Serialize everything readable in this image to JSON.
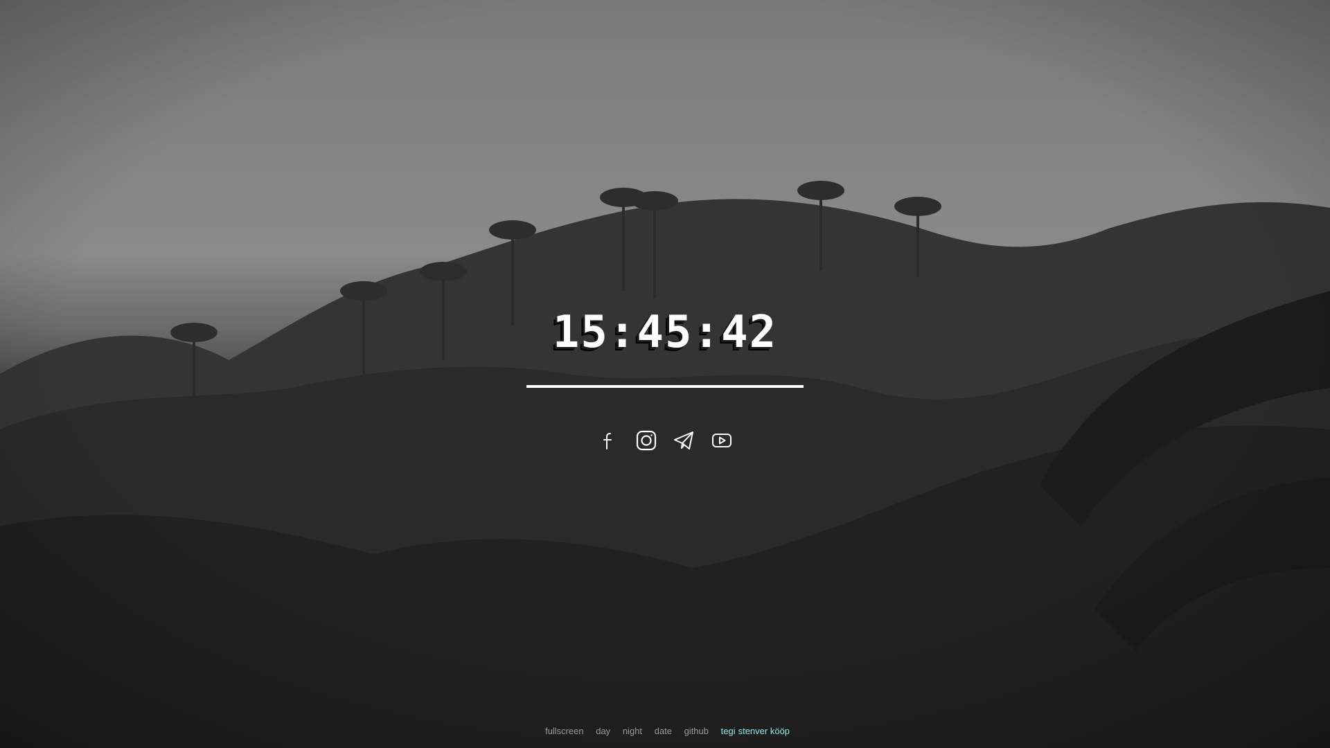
{
  "clock": {
    "time": "15:45:42"
  },
  "socials": [
    {
      "name": "facebook-icon"
    },
    {
      "name": "instagram-icon"
    },
    {
      "name": "telegram-icon"
    },
    {
      "name": "youtube-icon"
    }
  ],
  "footer": {
    "links": [
      "fullscreen",
      "day",
      "night",
      "date",
      "github"
    ],
    "credit_prefix": "tegi",
    "credit_author": "stenver kööp"
  },
  "colors": {
    "clock": "#ffffff",
    "footer_link": "#9a9a9a",
    "credit": "#8fe6e6"
  }
}
